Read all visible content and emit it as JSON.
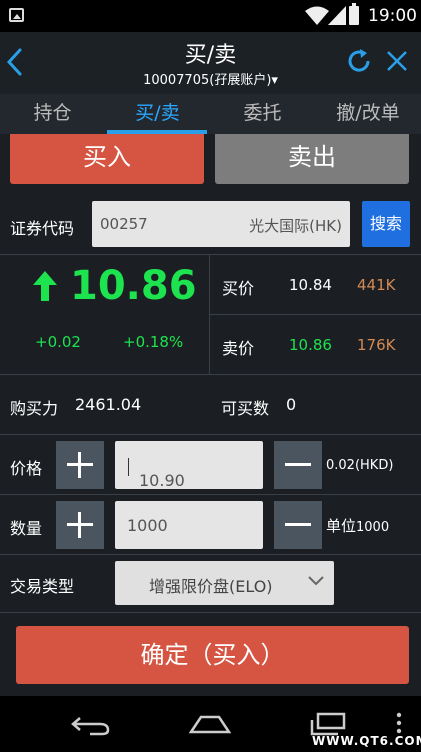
{
  "status_bar": {
    "time": "19:00"
  },
  "header": {
    "title": "买/卖",
    "account": "10007705(孖展账户)▾"
  },
  "tabs": [
    {
      "label": "持仓"
    },
    {
      "label": "买/卖"
    },
    {
      "label": "委托"
    },
    {
      "label": "撤/改单"
    }
  ],
  "actions": {
    "buy": "买入",
    "sell": "卖出"
  },
  "security": {
    "label": "证券代码",
    "code": "00257",
    "name": "光大国际(HK)",
    "search": "搜索"
  },
  "quote": {
    "price": "10.86",
    "change": "+0.02",
    "change_pct": "+0.18%",
    "bid_label": "买价",
    "bid_price": "10.84",
    "bid_vol": "441K",
    "ask_label": "卖价",
    "ask_price": "10.86",
    "ask_vol": "176K"
  },
  "power": {
    "label": "购买力",
    "value": "2461.04",
    "max_label": "可买数",
    "max_value": "0"
  },
  "price_row": {
    "label": "价格",
    "value": "10.90",
    "step": "0.02(HKD)"
  },
  "qty_row": {
    "label": "数量",
    "value": "1000",
    "unit_label": "单位",
    "unit_value": "1000"
  },
  "order_type": {
    "label": "交易类型",
    "selected": "增强限价盘(ELO)"
  },
  "confirm": "确定（买入）",
  "watermark": "WWW.QT6.COM",
  "colors": {
    "up": "#1de34f",
    "buy": "#d65442",
    "sell": "#7d7d7d",
    "accent": "#2aa8ff",
    "volume": "#d48a52"
  }
}
